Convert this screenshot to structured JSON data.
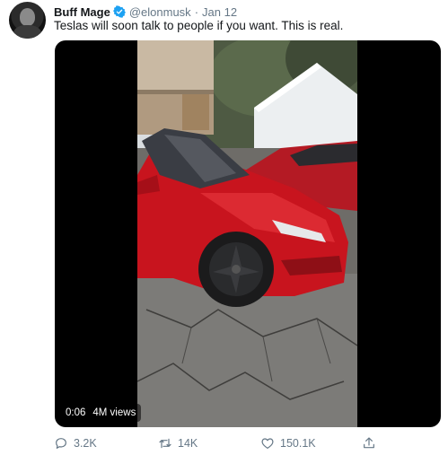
{
  "tweet": {
    "display_name": "Buff Mage",
    "handle": "@elonmusk",
    "separator": "·",
    "date": "Jan 12",
    "text": "Teslas will soon talk to people if you want. This is real."
  },
  "video": {
    "time": "0:06",
    "views": "4M views"
  },
  "actions": {
    "reply_count": "3.2K",
    "retweet_count": "14K",
    "like_count": "150.1K"
  },
  "colors": {
    "verified": "#1da1f2",
    "muted_text": "#657786",
    "car_red": "#c8141e"
  }
}
